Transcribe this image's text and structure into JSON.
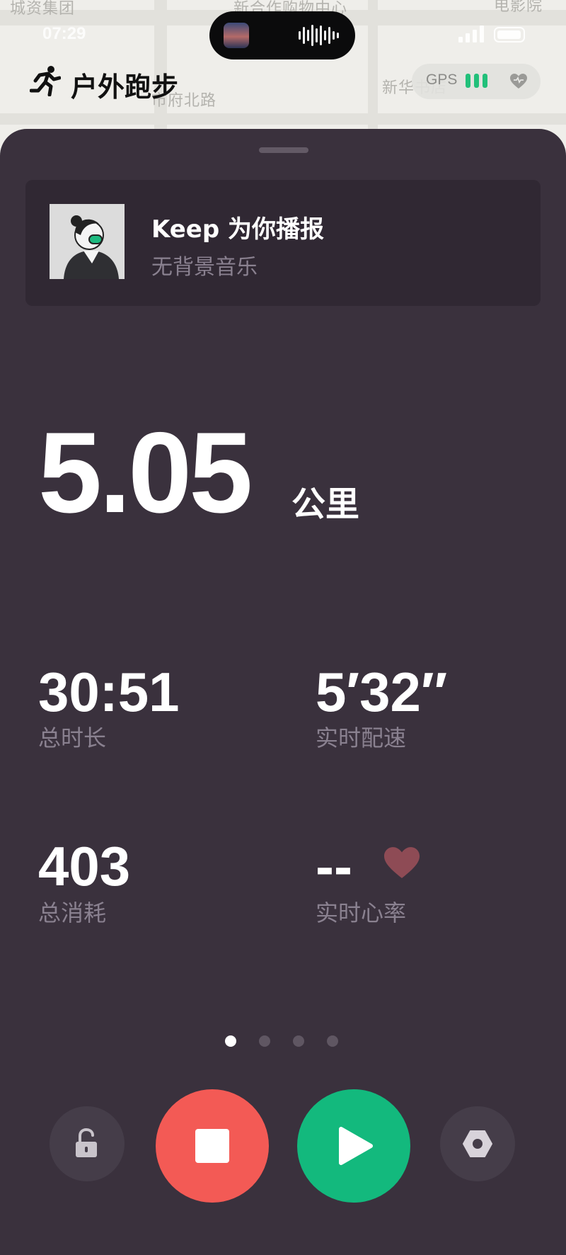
{
  "map": {
    "labels": [
      "城资集团",
      "新合作购物中心",
      "电影院",
      "市府北路",
      "新华书店"
    ]
  },
  "status_bar": {
    "time": "07:29"
  },
  "header": {
    "title": "户外跑步",
    "icon": "runner-icon",
    "gps_label": "GPS",
    "gps_signal_bars": 3,
    "heart_icon": "heart-outline-icon"
  },
  "voice_card": {
    "title": "Keep 为你播报",
    "subtitle": "无背景音乐",
    "avatar": "coach-avatar"
  },
  "distance": {
    "value": "5.05",
    "unit": "公里"
  },
  "stats": {
    "duration": {
      "value": "30:51",
      "label": "总时长"
    },
    "pace": {
      "value": "5′32″",
      "label": "实时配速"
    },
    "calories": {
      "value": "403",
      "label": "总消耗"
    },
    "heart_rate": {
      "value": "--",
      "label": "实时心率"
    }
  },
  "pager": {
    "count": 4,
    "active": 0
  },
  "controls": {
    "lock": "unlock-icon",
    "stop": "stop-icon",
    "resume": "play-icon",
    "settings": "settings-icon"
  },
  "colors": {
    "panel": "#3a313d",
    "stop": "#f35a55",
    "play": "#13b97d",
    "gps": "#22c07a",
    "heart": "#8e4b55"
  }
}
